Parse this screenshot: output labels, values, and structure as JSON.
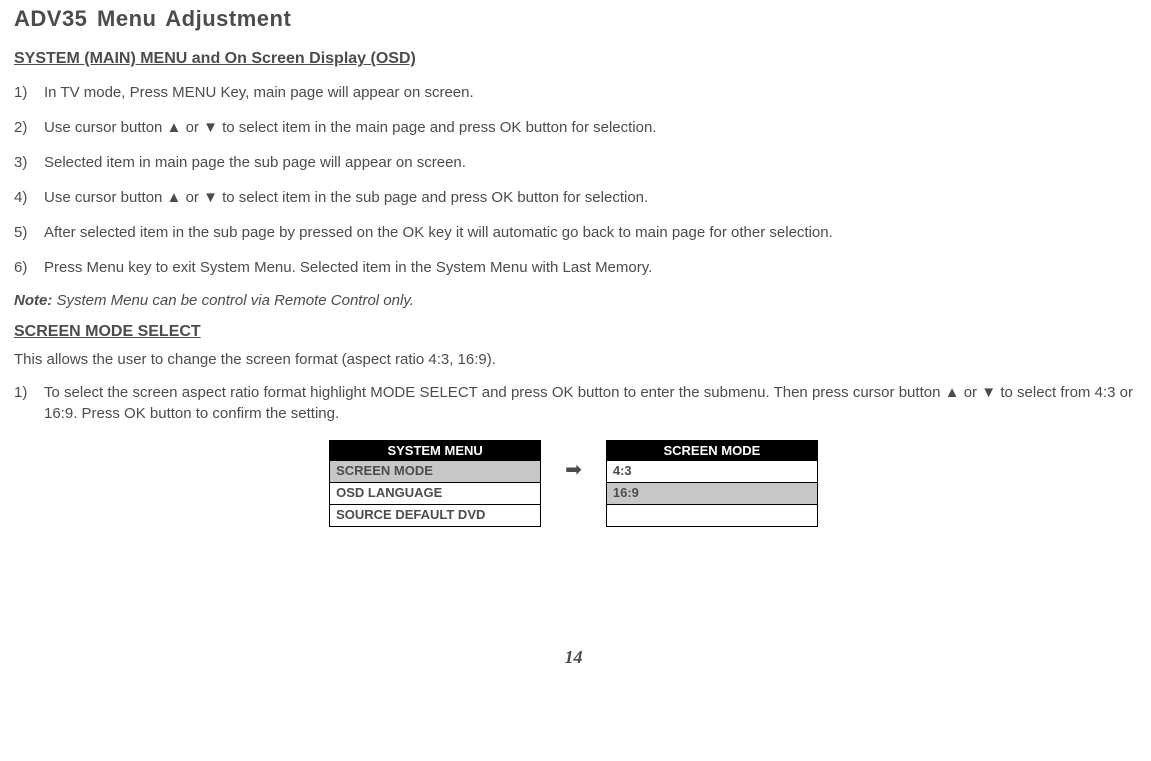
{
  "title": "ADV35 Menu Adjustment",
  "heading_system": "SYSTEM (MAIN) MENU and On Screen Display (OSD)",
  "steps_main": [
    "In TV mode, Press MENU Key, main page will appear on screen.",
    "Use cursor button ▲ or ▼ to select item in the main page and press OK button for selection.",
    "Selected item in main page the sub page will appear on screen.",
    "Use cursor button ▲ or ▼ to select item in the sub page and press OK button for selection.",
    "After selected item in the sub page by pressed on the OK key it will automatic go back to main page for other selection.",
    "Press Menu key to exit System Menu. Selected item in the System Menu with Last Memory."
  ],
  "note_label": "Note:",
  "note_text": " System Menu can be control via Remote Control only.",
  "heading_screen": "SCREEN MODE SELECT",
  "screen_intro": "This allows the user to change the screen format (aspect ratio 4:3, 16:9).",
  "steps_screen": [
    "To select the screen aspect ratio format highlight MODE SELECT and press OK button to enter the submenu. Then press cursor button ▲ or ▼ to select from 4:3 or 16:9. Press OK button to confirm the setting."
  ],
  "menu_left": {
    "header": "SYSTEM MENU",
    "items": [
      "SCREEN MODE",
      "OSD LANGUAGE",
      "SOURCE DEFAULT DVD"
    ],
    "selected_index": 0
  },
  "menu_right": {
    "header": "SCREEN MODE",
    "items": [
      "4:3",
      "16:9",
      ""
    ],
    "selected_index": 1
  },
  "page_number": "14"
}
